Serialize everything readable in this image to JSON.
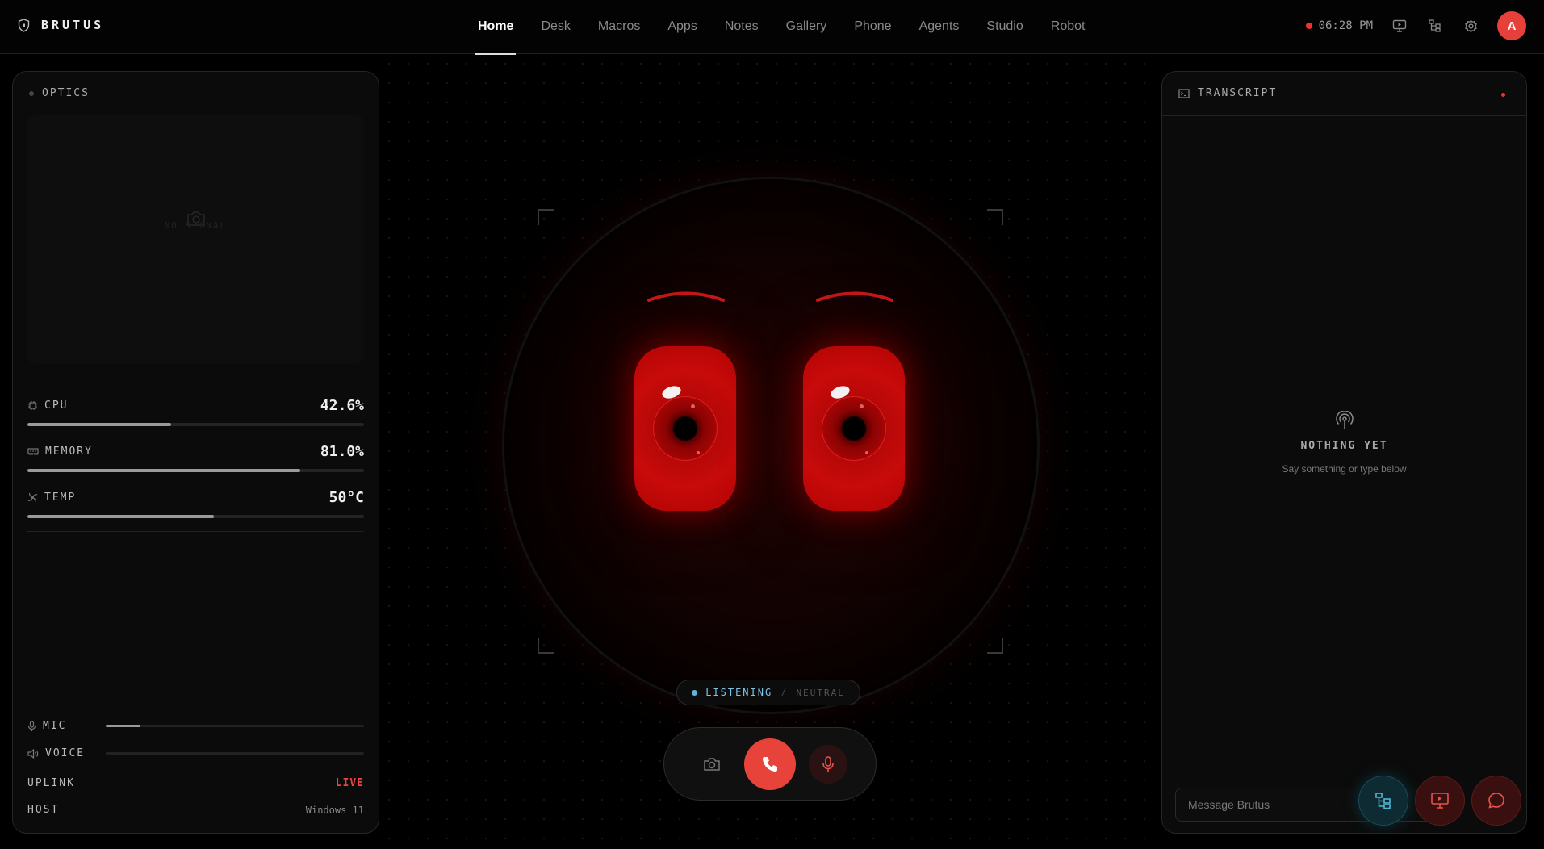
{
  "brand": {
    "name": "BRUTUS",
    "icon": "shield-icon"
  },
  "nav": {
    "items": [
      {
        "label": "Home",
        "active": true
      },
      {
        "label": "Desk"
      },
      {
        "label": "Macros"
      },
      {
        "label": "Apps"
      },
      {
        "label": "Notes"
      },
      {
        "label": "Gallery"
      },
      {
        "label": "Phone"
      },
      {
        "label": "Agents"
      },
      {
        "label": "Studio"
      },
      {
        "label": "Robot"
      }
    ]
  },
  "status": {
    "time": "06:28 PM",
    "avatar": "A",
    "icons": [
      "monitor-icon",
      "hierarchy-icon",
      "gear-icon"
    ]
  },
  "optics": {
    "title": "OPTICS",
    "no_signal": "NO SIGNAL"
  },
  "metrics": {
    "cpu": {
      "label": "CPU",
      "value": "42.6%",
      "fraction": 0.426
    },
    "memory": {
      "label": "MEMORY",
      "value": "81.0%",
      "fraction": 0.81
    },
    "temp": {
      "label": "TEMP",
      "value": "50°C",
      "fraction": 0.555
    }
  },
  "audio": {
    "mic": {
      "label": "MIC",
      "level": 0.13
    },
    "voice": {
      "label": "VOICE",
      "level": 0.0
    }
  },
  "system": {
    "uplink": {
      "label": "UPLINK",
      "value": "LIVE"
    },
    "host": {
      "label": "HOST",
      "value": "Windows 11"
    }
  },
  "state": {
    "mode": "LISTENING",
    "separator": "/",
    "emotion": "NEUTRAL"
  },
  "colors": {
    "accent": "#e8433b",
    "eye": "#c80a0a",
    "listening": "#5fb4d8"
  },
  "transcript": {
    "title": "TRANSCRIPT",
    "empty_title": "NOTHING YET",
    "empty_sub": "Say something or type below",
    "placeholder": "Message Brutus"
  }
}
